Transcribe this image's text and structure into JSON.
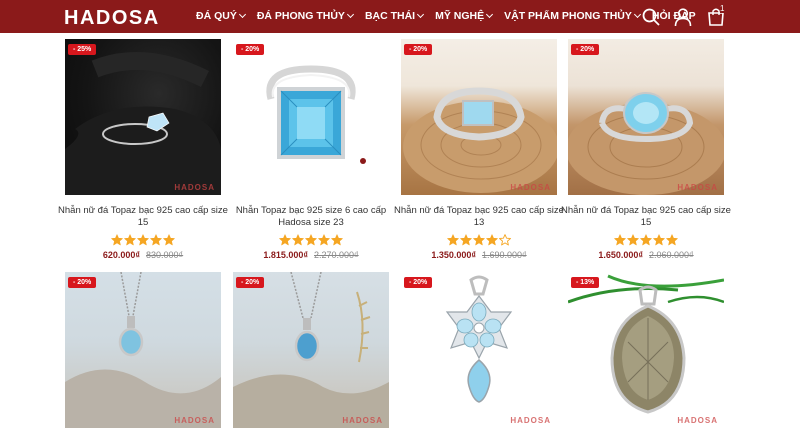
{
  "header": {
    "logo": "HADOSA",
    "nav": [
      {
        "label": "ĐÁ QUÝ",
        "dropdown": true
      },
      {
        "label": "ĐÁ PHONG THỦY",
        "dropdown": true
      },
      {
        "label": "BẠC THÁI",
        "dropdown": true
      },
      {
        "label": "MỸ NGHỆ",
        "dropdown": true
      },
      {
        "label": "VẬT PHẨM PHONG THỦY",
        "dropdown": true
      },
      {
        "label": "HỎI ĐÁP",
        "dropdown": false
      }
    ],
    "icons": [
      "search-icon",
      "user-icon",
      "cart-icon"
    ],
    "cart_count": "1"
  },
  "colors": {
    "brand": "#8b1a1a",
    "badge": "#d7171d",
    "star": "#f5a623"
  },
  "products": [
    {
      "discount": "- 25%",
      "title": "Nhẫn nữ đá Topaz bạc 925 cao cấp size 15",
      "rating": 5,
      "price": "620.000₫",
      "old_price": "830.000₫",
      "watermark": "HADOSA"
    },
    {
      "discount": "- 20%",
      "title": "Nhẫn Topaz bạc 925 size 6 cao cấp Hadosa size 23",
      "rating": 5,
      "price": "1.815.000₫",
      "old_price": "2.270.000₫",
      "watermark": ""
    },
    {
      "discount": "- 20%",
      "title": "Nhẫn nữ đá Topaz bạc 925 cao cấp size 13",
      "rating": 4,
      "price": "1.350.000₫",
      "old_price": "1.690.000₫",
      "watermark": "HADOSA"
    },
    {
      "discount": "- 20%",
      "title": "Nhẫn nữ đá Topaz bạc 925 cao cấp size 15",
      "rating": 5,
      "price": "1.650.000₫",
      "old_price": "2.060.000₫",
      "watermark": "HADOSA"
    },
    {
      "discount": "- 20%",
      "title": "",
      "rating": 0,
      "price": "",
      "old_price": "",
      "watermark": "HADOSA"
    },
    {
      "discount": "- 20%",
      "title": "",
      "rating": 0,
      "price": "",
      "old_price": "",
      "watermark": "HADOSA"
    },
    {
      "discount": "- 20%",
      "title": "",
      "rating": 0,
      "price": "",
      "old_price": "",
      "watermark": "HADOSA"
    },
    {
      "discount": "- 13%",
      "title": "",
      "rating": 0,
      "price": "",
      "old_price": "",
      "watermark": "HADOSA"
    }
  ]
}
